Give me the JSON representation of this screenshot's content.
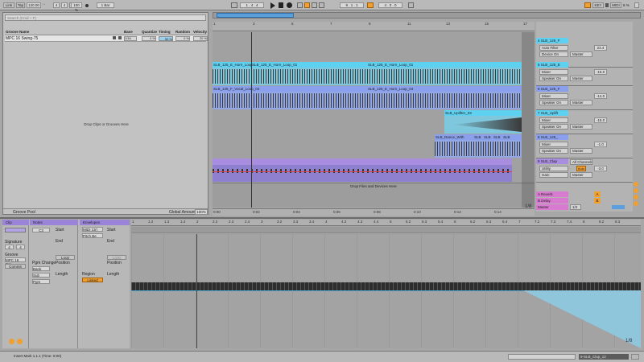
{
  "transport": {
    "link": "Link",
    "tap": "Tap",
    "tempo": "120.00",
    "sig_num": "4",
    "sig_den": "4",
    "zoom": "100 %",
    "quant": "1 Bar",
    "position": "1 . 4 . 4",
    "loop_start": "9 . 1 . 1",
    "loop_len": "4 . 0 . 0",
    "key": "KEY",
    "midi": "MIDI",
    "cpu": "6 %"
  },
  "groove_pool": {
    "search_placeholder": "Search (Cmd + F)",
    "headers": [
      "Groove Name",
      "Base",
      "Quantize",
      "Timing",
      "Random",
      "Velocity"
    ],
    "row": {
      "name": "MPC 16 Swing-75",
      "base": "1/16",
      "quantize": "0 %",
      "timing": "50 %",
      "random": "0 %",
      "velocity": "20 %"
    },
    "drop_text": "Drop Clips or Grooves Here",
    "footer_label": "Groove Pool",
    "global_amount_label": "Global Amount",
    "global_amount": "100%"
  },
  "arrangement": {
    "bar_numbers": [
      "1",
      "3",
      "5",
      "7",
      "9",
      "11",
      "13",
      "15",
      "17"
    ],
    "time_labels": [
      "0:00",
      "0:02",
      "0:04",
      "0:06",
      "0:08",
      "0:10",
      "0:12",
      "0:14"
    ],
    "drop_text": "Drop Files and Devices Here",
    "clips": {
      "horn1": "SLB_125_E_Horn_Loop_01",
      "horn2": "SLB_125_E_Horn_Loop_01",
      "horn3": "SLB_125_E_Horn_Loop_01",
      "vocal1": "SLB_125_F_Vocal_Loop_04",
      "vocal2": "SLB_125_E_Horn_Loop_04",
      "uplifter": "SLB_Uplifter_03",
      "dance": "SLB_Dance_With",
      "dance_b": "SLB",
      "dance_c": "SLB",
      "dance_d": "SLB",
      "dance_e": "SLB"
    }
  },
  "tracks": [
    {
      "name": "4 SLB_125_F",
      "device": "Auto Filter",
      "sub": "Device On",
      "val": "23.4",
      "route": "Master",
      "color": "#5ed0f0"
    },
    {
      "name": "5 SLB_125_E",
      "device": "Mixer",
      "sub": "Speaker On",
      "val": "-15.0",
      "route": "Master",
      "color": "#5ed0f0"
    },
    {
      "name": "6 SLB_125_F",
      "device": "Mixer",
      "sub": "Speaker On",
      "val": "-14.0",
      "route": "Master",
      "color": "#8aa0ec"
    },
    {
      "name": "7 SLB_Uplift",
      "device": "Mixer",
      "sub": "Speaker On",
      "val": "-15.0",
      "route": "Master",
      "color": "#5ed0f0"
    },
    {
      "name": "8 SLB_125_",
      "device": "Mixer",
      "sub": "Speaker On",
      "val": "-1.0",
      "route": "Master",
      "color": "#8aa0ec"
    },
    {
      "name": "9 SLB_Clap",
      "device": "Utility",
      "sub": "Gain",
      "val": "-3.0",
      "route": "Master",
      "color": "#a98ee0"
    }
  ],
  "returns": [
    {
      "name": "A Reverb",
      "val": "A",
      "color": "#d87ad0"
    },
    {
      "name": "B Delay",
      "val": "B",
      "color": "#d87ad0"
    },
    {
      "name": "Master",
      "val": "1/2",
      "color": "#d87ad0"
    }
  ],
  "mixer_headers": {
    "all_channels": "All Channels",
    "auto": "Auto",
    "off": "Off",
    "in": "In"
  },
  "fraction_arr": "1/8",
  "clip_view": {
    "clip_title": "Clip",
    "notes_title": "Notes",
    "env_title": "Envelopes",
    "start_label": "Start",
    "end_label": "End",
    "loop_label": "Loop",
    "position_label": "Position",
    "length_label": "Length",
    "signature_label": "Signature",
    "groove_label": "Groove",
    "groove_value": "MPC 16 Swi",
    "commit_label": "Commit",
    "pgm_change_label": "Pgm Change",
    "bank_label": "Bank",
    "sub_label": "Sub",
    "pgm_label": "Pgm",
    "midi_ctrl": "MIDI Ctrl",
    "pitch_bend": "Pitch Be",
    "region_label": "Region",
    "linked_label": "Linked",
    "sig_num": "4",
    "sig_den": "4",
    "note_key": "C3",
    "fraction": "1/8",
    "ruler": [
      "1",
      "1.2",
      "1.3",
      "1.4",
      "2",
      "2.2",
      "2.3",
      "2.4",
      "3",
      "3.2",
      "3.3",
      "3.4",
      "4",
      "4.2",
      "4.3",
      "4.4",
      "5",
      "5.2",
      "5.3",
      "5.4",
      "6",
      "6.2",
      "6.3",
      "6.4",
      "7",
      "7.2",
      "7.3",
      "7.4",
      "8",
      "8.2",
      "8.3"
    ]
  },
  "status": {
    "message": "Insert Mark 1.1.1 (Time: 0:00)",
    "track": "9-SLB_Clap_12"
  }
}
